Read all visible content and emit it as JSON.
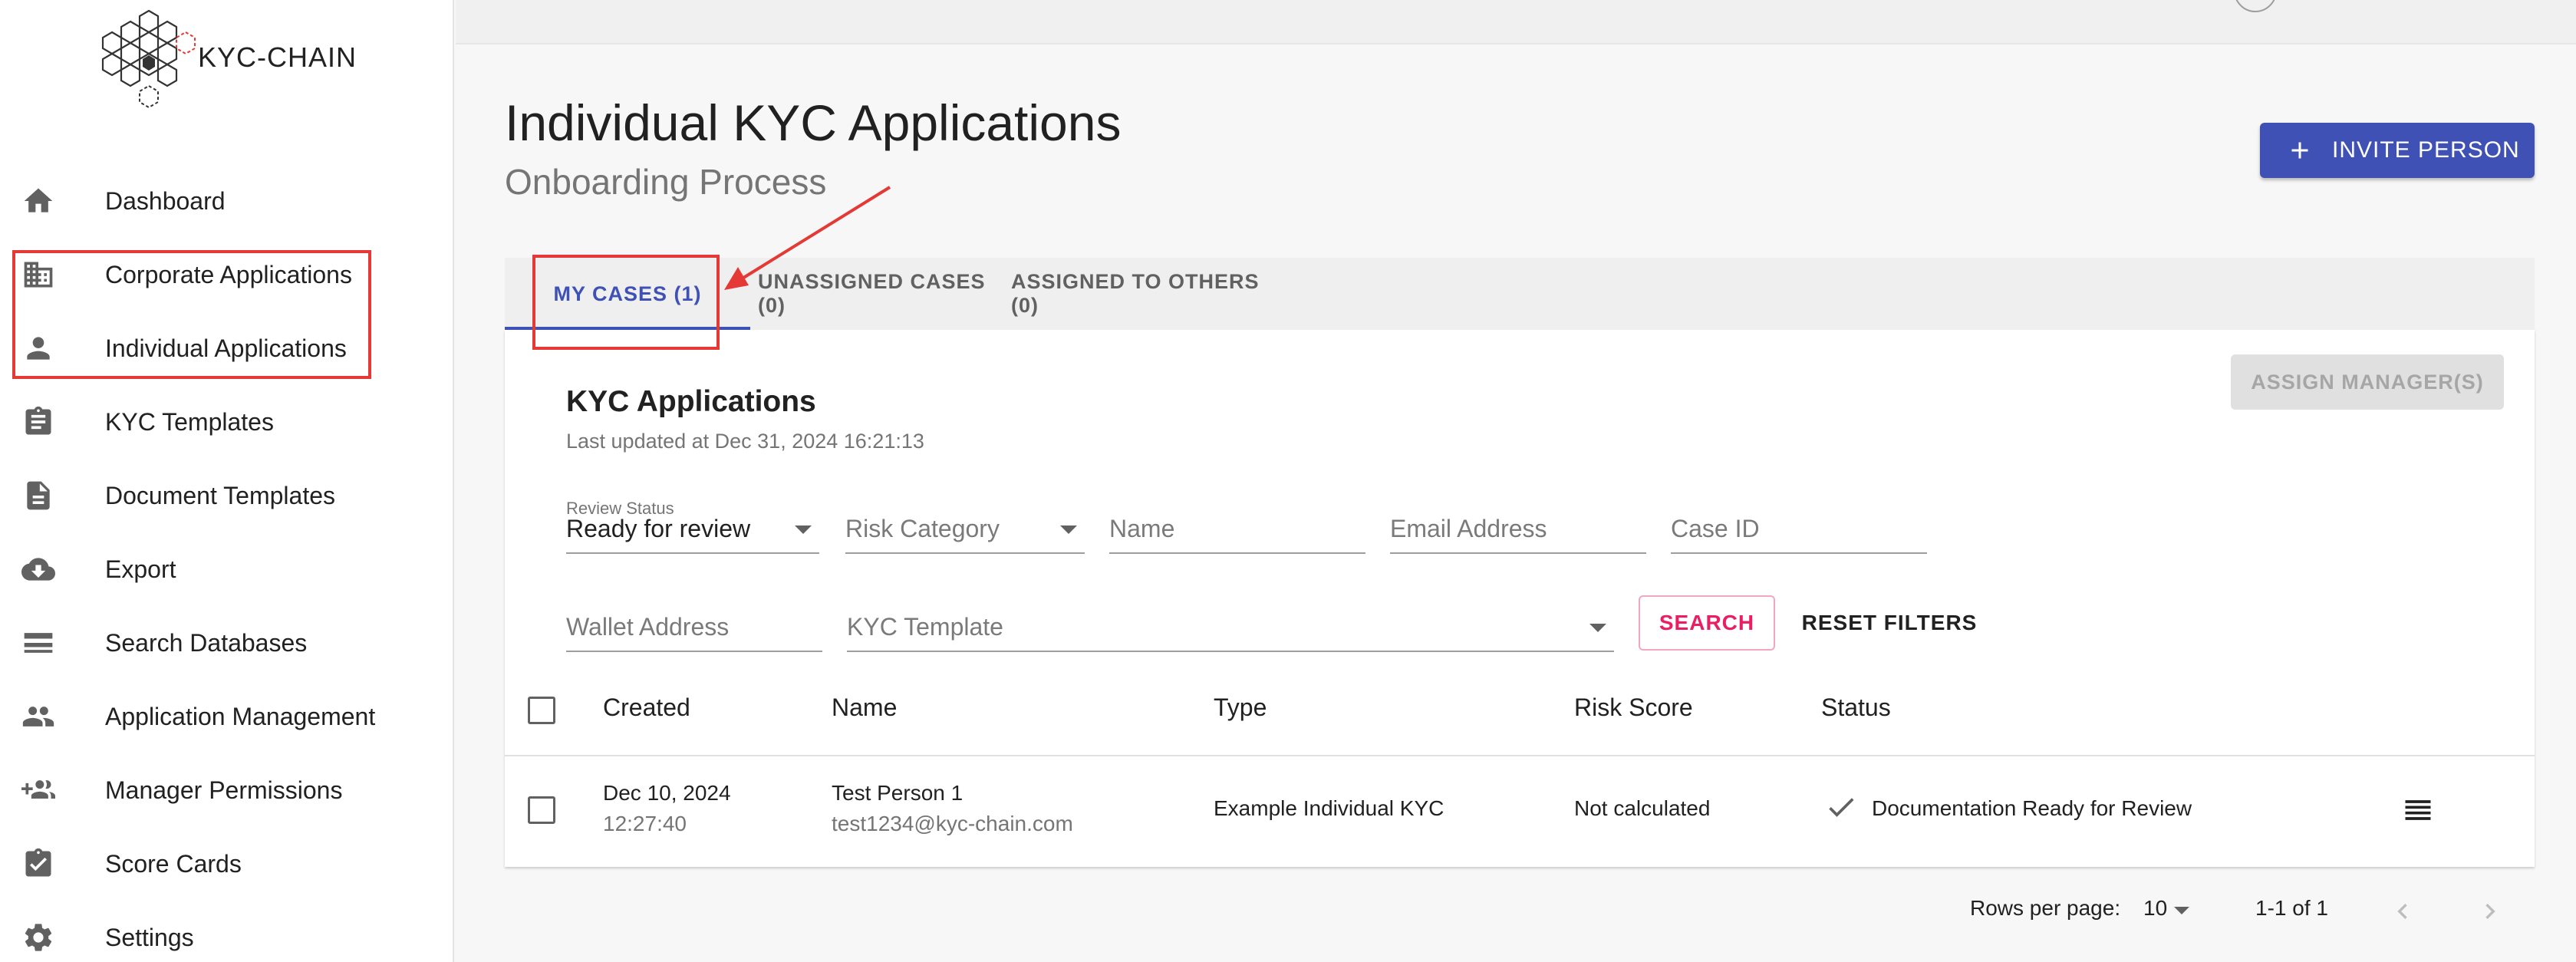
{
  "brand": {
    "logo_text": "KYC-CHAIN"
  },
  "sidebar": {
    "items": [
      {
        "label": "Dashboard",
        "icon": "home-icon"
      },
      {
        "label": "Corporate Applications",
        "icon": "building-icon"
      },
      {
        "label": "Individual Applications",
        "icon": "person-icon"
      },
      {
        "label": "KYC Templates",
        "icon": "clipboard-icon"
      },
      {
        "label": "Document Templates",
        "icon": "document-icon"
      },
      {
        "label": "Export",
        "icon": "cloud-download-icon"
      },
      {
        "label": "Search Databases",
        "icon": "list-icon"
      },
      {
        "label": "Application Management",
        "icon": "people-icon"
      },
      {
        "label": "Manager Permissions",
        "icon": "group-add-icon"
      },
      {
        "label": "Score Cards",
        "icon": "assignment-check-icon"
      },
      {
        "label": "Settings",
        "icon": "gear-icon"
      }
    ]
  },
  "header": {
    "title": "Individual KYC Applications",
    "subtitle": "Onboarding Process",
    "invite_label": "INVITE PERSON"
  },
  "tabs": [
    {
      "label": "MY CASES (1)",
      "active": true
    },
    {
      "label": "UNASSIGNED CASES (0)",
      "active": false
    },
    {
      "label": "ASSIGNED TO OTHERS (0)",
      "active": false
    }
  ],
  "card": {
    "assign_label": "ASSIGN MANAGER(S)",
    "title": "KYC Applications",
    "updated": "Last updated at Dec 31, 2024 16:21:13"
  },
  "filters": {
    "review_status_label": "Review Status",
    "review_status_value": "Ready for review",
    "risk_category": "Risk Category",
    "name": "Name",
    "email": "Email Address",
    "case_id": "Case ID",
    "wallet": "Wallet Address",
    "kyc_template": "KYC Template",
    "search_label": "SEARCH",
    "reset_label": "RESET FILTERS"
  },
  "table": {
    "columns": [
      "Created",
      "Name",
      "Type",
      "Risk Score",
      "Status"
    ],
    "rows": [
      {
        "created_date": "Dec 10, 2024",
        "created_time": "12:27:40",
        "name": "Test Person 1",
        "email": "test1234@kyc-chain.com",
        "type": "Example Individual KYC",
        "risk_score": "Not calculated",
        "status": "Documentation Ready for Review"
      }
    ]
  },
  "pagination": {
    "rows_label": "Rows per page:",
    "rows_value": "10",
    "range": "1-1 of 1"
  },
  "colors": {
    "accent": "#3f51b5",
    "search_accent": "#e91e63",
    "annotation": "#e53935"
  }
}
